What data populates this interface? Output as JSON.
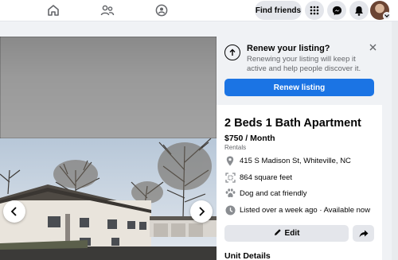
{
  "topbar": {
    "nav_icons": [
      "home-icon",
      "people-icon",
      "groups-icon"
    ],
    "find_friends_label": "Find friends",
    "action_icons": [
      "menu-grid-icon",
      "messenger-icon",
      "notifications-bell-icon"
    ],
    "profile_icon": "avatar",
    "accent": "#1b74e4"
  },
  "gallery": {
    "prev_icon": "chevron-left-icon",
    "next_icon": "chevron-right-icon"
  },
  "renew": {
    "title": "Renew your listing?",
    "description": "Renewing your listing will keep it active and help people discover it.",
    "button_label": "Renew listing",
    "close_icon": "close-icon"
  },
  "listing": {
    "title": "2 Beds 1 Bath Apartment",
    "price": "$750 / Month",
    "category": "Rentals",
    "details": [
      {
        "icon": "location-pin-icon",
        "text": "415 S Madison St, Whiteville, NC"
      },
      {
        "icon": "square-feet-icon",
        "text": "864 square feet"
      },
      {
        "icon": "paw-icon",
        "text": "Dog and cat friendly"
      },
      {
        "icon": "clock-icon",
        "text": "Listed over a week ago · Available now"
      }
    ],
    "edit_label": "Edit",
    "share_icon": "share-icon",
    "section_title": "Unit Details"
  }
}
